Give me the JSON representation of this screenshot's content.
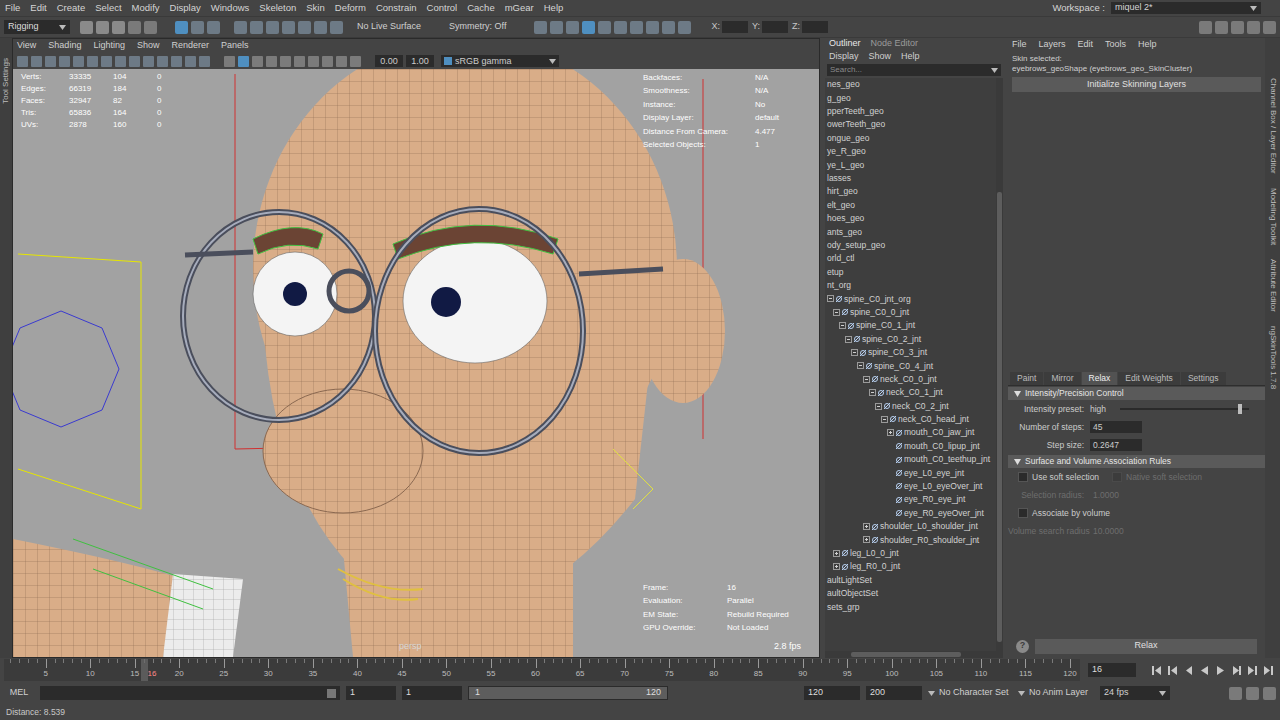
{
  "menu_bar": {
    "items": [
      "File",
      "Edit",
      "Create",
      "Select",
      "Modify",
      "Display",
      "Windows",
      "Skeleton",
      "Skin",
      "Deform",
      "Constrain",
      "Control",
      "Cache",
      "mGear",
      "Help"
    ],
    "workspace_label": "Workspace :",
    "workspace": "miquel 2*"
  },
  "status_line": {
    "mode": "Rigging",
    "live_surface": "No Live Surface",
    "symmetry": "Symmetry: Off",
    "coords": [
      "X:",
      "Y:",
      "Z:"
    ]
  },
  "left_strip": [
    "Tool Settings"
  ],
  "right_strip": [
    "Channel Box / Layer Editor",
    "Modeling Toolkit",
    "Attribute Editor",
    "ngSkinTools 1.7.8"
  ],
  "viewport": {
    "menu": [
      "View",
      "Shading",
      "Lighting",
      "Show",
      "Renderer",
      "Panels"
    ],
    "toolbar_values": [
      "0.00",
      "1.00"
    ],
    "color_space": "sRGB gamma",
    "hud_stats": [
      {
        "label": "Verts:",
        "values": [
          "33335",
          "104",
          "0"
        ]
      },
      {
        "label": "Edges:",
        "values": [
          "66319",
          "184",
          "0"
        ]
      },
      {
        "label": "Faces:",
        "values": [
          "32947",
          "82",
          "0"
        ]
      },
      {
        "label": "Tris:",
        "values": [
          "65836",
          "164",
          "0"
        ]
      },
      {
        "label": "UVs:",
        "values": [
          "2878",
          "160",
          "0"
        ]
      }
    ],
    "hud_info": [
      {
        "label": "Backfaces:",
        "value": "N/A"
      },
      {
        "label": "Smoothness:",
        "value": "N/A"
      },
      {
        "label": "Instance:",
        "value": "No"
      },
      {
        "label": "Display Layer:",
        "value": "default"
      },
      {
        "label": "Distance From Camera:",
        "value": "4.477"
      },
      {
        "label": "Selected Objects:",
        "value": "1"
      }
    ],
    "hud_status": [
      {
        "label": "Frame:",
        "value": "16"
      },
      {
        "label": "Evaluation:",
        "value": "Parallel"
      },
      {
        "label": "EM State:",
        "value": "Rebuild Required"
      },
      {
        "label": "GPU Override:",
        "value": "Not Loaded"
      }
    ],
    "fps": "2.8 fps",
    "camera": "persp"
  },
  "outliner": {
    "tabs": [
      {
        "label": "Outliner",
        "selected": true
      },
      {
        "label": "Node Editor",
        "selected": false
      }
    ],
    "menu": [
      "Display",
      "Show",
      "Help"
    ],
    "search_placeholder": "Search...",
    "items": [
      {
        "label": "nes_geo",
        "kind": "clipped",
        "depth": 0,
        "has_children": false,
        "expanded": false
      },
      {
        "label": "g_geo",
        "kind": "clipped",
        "depth": 0,
        "has_children": false,
        "expanded": false
      },
      {
        "label": "pperTeeth_geo",
        "kind": "clipped",
        "depth": 0,
        "has_children": false,
        "expanded": false
      },
      {
        "label": "owerTeeth_geo",
        "kind": "clipped",
        "depth": 0,
        "has_children": false,
        "expanded": false
      },
      {
        "label": "ongue_geo",
        "kind": "clipped",
        "depth": 0,
        "has_children": false,
        "expanded": false
      },
      {
        "label": "ye_R_geo",
        "kind": "clipped",
        "depth": 0,
        "has_children": false,
        "expanded": false
      },
      {
        "label": "ye_L_geo",
        "kind": "clipped",
        "depth": 0,
        "has_children": false,
        "expanded": false
      },
      {
        "label": "lasses",
        "kind": "clipped",
        "depth": 0,
        "has_children": false,
        "expanded": false
      },
      {
        "label": "hirt_geo",
        "kind": "clipped",
        "depth": 0,
        "has_children": false,
        "expanded": false
      },
      {
        "label": "elt_geo",
        "kind": "clipped",
        "depth": 0,
        "has_children": false,
        "expanded": false
      },
      {
        "label": "hoes_geo",
        "kind": "clipped",
        "depth": 0,
        "has_children": false,
        "expanded": false
      },
      {
        "label": "ants_geo",
        "kind": "clipped",
        "depth": 0,
        "has_children": false,
        "expanded": false
      },
      {
        "label": "ody_setup_geo",
        "kind": "clipped",
        "depth": 0,
        "has_children": false,
        "expanded": false
      },
      {
        "label": "orld_ctl",
        "kind": "clipped",
        "depth": 0,
        "has_children": false,
        "expanded": false
      },
      {
        "label": "etup",
        "kind": "clipped",
        "depth": 0,
        "has_children": false,
        "expanded": false
      },
      {
        "label": "nt_org",
        "kind": "clipped",
        "depth": 0,
        "has_children": false,
        "expanded": false
      },
      {
        "label": "spine_C0_jnt_org",
        "kind": "joint",
        "depth": 0,
        "has_children": true,
        "expanded": true
      },
      {
        "label": "spine_C0_0_jnt",
        "kind": "joint",
        "depth": 1,
        "has_children": true,
        "expanded": true
      },
      {
        "label": "spine_C0_1_jnt",
        "kind": "joint",
        "depth": 2,
        "has_children": true,
        "expanded": true
      },
      {
        "label": "spine_C0_2_jnt",
        "kind": "joint",
        "depth": 3,
        "has_children": true,
        "expanded": true
      },
      {
        "label": "spine_C0_3_jnt",
        "kind": "joint",
        "depth": 4,
        "has_children": true,
        "expanded": true
      },
      {
        "label": "spine_C0_4_jnt",
        "kind": "joint",
        "depth": 5,
        "has_children": true,
        "expanded": true
      },
      {
        "label": "neck_C0_0_jnt",
        "kind": "joint",
        "depth": 6,
        "has_children": true,
        "expanded": true
      },
      {
        "label": "neck_C0_1_jnt",
        "kind": "joint",
        "depth": 7,
        "has_children": true,
        "expanded": true
      },
      {
        "label": "neck_C0_2_jnt",
        "kind": "joint",
        "depth": 8,
        "has_children": true,
        "expanded": true
      },
      {
        "label": "neck_C0_head_jnt",
        "kind": "joint",
        "depth": 9,
        "has_children": true,
        "expanded": true
      },
      {
        "label": "mouth_C0_jaw_jnt",
        "kind": "joint",
        "depth": 10,
        "has_children": true,
        "expanded": false
      },
      {
        "label": "mouth_C0_lipup_jnt",
        "kind": "joint",
        "depth": 10,
        "has_children": false,
        "expanded": false
      },
      {
        "label": "mouth_C0_teethup_jnt",
        "kind": "joint",
        "depth": 10,
        "has_children": false,
        "expanded": false
      },
      {
        "label": "eye_L0_eye_jnt",
        "kind": "joint",
        "depth": 10,
        "has_children": false,
        "expanded": false
      },
      {
        "label": "eye_L0_eyeOver_jnt",
        "kind": "joint",
        "depth": 10,
        "has_children": false,
        "expanded": false
      },
      {
        "label": "eye_R0_eye_jnt",
        "kind": "joint",
        "depth": 10,
        "has_children": false,
        "expanded": false
      },
      {
        "label": "eye_R0_eyeOver_jnt",
        "kind": "joint",
        "depth": 10,
        "has_children": false,
        "expanded": false
      },
      {
        "label": "shoulder_L0_shoulder_jnt",
        "kind": "joint",
        "depth": 6,
        "has_children": true,
        "expanded": false
      },
      {
        "label": "shoulder_R0_shoulder_jnt",
        "kind": "joint",
        "depth": 6,
        "has_children": true,
        "expanded": false
      },
      {
        "label": "leg_L0_0_jnt",
        "kind": "joint",
        "depth": 1,
        "has_children": true,
        "expanded": false
      },
      {
        "label": "leg_R0_0_jnt",
        "kind": "joint",
        "depth": 1,
        "has_children": true,
        "expanded": false
      },
      {
        "label": "aultLightSet",
        "kind": "clipped",
        "depth": 0,
        "has_children": false,
        "expanded": false
      },
      {
        "label": "aultObjectSet",
        "kind": "clipped",
        "depth": 0,
        "has_children": false,
        "expanded": false
      },
      {
        "label": "sets_grp",
        "kind": "clipped",
        "depth": 0,
        "has_children": false,
        "expanded": false
      }
    ]
  },
  "skin_panel": {
    "menu": [
      "File",
      "Layers",
      "Edit",
      "Tools",
      "Help"
    ],
    "skin_selected_label": "Skin selected:",
    "skin_selected": "eyebrows_geoShape (eyebrows_geo_SkinCluster)",
    "init_button": "Initialize Skinning Layers",
    "tabs": [
      {
        "label": "Paint",
        "selected": false
      },
      {
        "label": "Mirror",
        "selected": false
      },
      {
        "label": "Relax",
        "selected": true
      },
      {
        "label": "Edit Weights",
        "selected": false
      },
      {
        "label": "Settings",
        "selected": false
      }
    ],
    "sections": [
      {
        "title": "Intensity/Precision Control",
        "expanded": true,
        "rows": [
          {
            "kind": "slider",
            "label": "Intensity preset:",
            "value": "high",
            "level": 0.93,
            "disabled": false
          },
          {
            "kind": "field",
            "label": "Number of steps:",
            "value": "45",
            "disabled": false
          },
          {
            "kind": "field",
            "label": "Step size:",
            "value": "0.2647",
            "disabled": false
          }
        ]
      },
      {
        "title": "Surface and Volume Association Rules",
        "expanded": true,
        "rows": [
          {
            "kind": "checkbox_pair",
            "label": "Use soft selection",
            "checked": false,
            "disabled": false,
            "second_label": "Native soft selection",
            "second_checked": false,
            "second_disabled": true
          },
          {
            "kind": "field",
            "label": "Selection radius:",
            "value": "1.0000",
            "disabled": true
          },
          {
            "kind": "checkbox",
            "label": "Associate by volume",
            "checked": false,
            "disabled": false
          },
          {
            "kind": "field",
            "label": "Volume search radius:",
            "value": "10.0000",
            "disabled": true
          }
        ]
      }
    ],
    "help_icon": "?",
    "relax_button": "Relax"
  },
  "time_slider": {
    "labels": [
      "5",
      "10",
      "15",
      "20",
      "25",
      "30",
      "35",
      "40",
      "45",
      "50",
      "55",
      "60",
      "65",
      "70",
      "75",
      "80",
      "85",
      "90",
      "95",
      "100",
      "105",
      "110",
      "115",
      "120"
    ],
    "current_frame": "16"
  },
  "range_slider": {
    "command_label": "MEL",
    "start": "1",
    "playback_start": "1",
    "bar_start": "1",
    "bar_end": "120",
    "playback_end": "120",
    "end": "200",
    "character_set": "No Character Set",
    "anim_layer": "No Anim Layer",
    "fps": "24 fps"
  },
  "help_line": "Distance: 8.539"
}
